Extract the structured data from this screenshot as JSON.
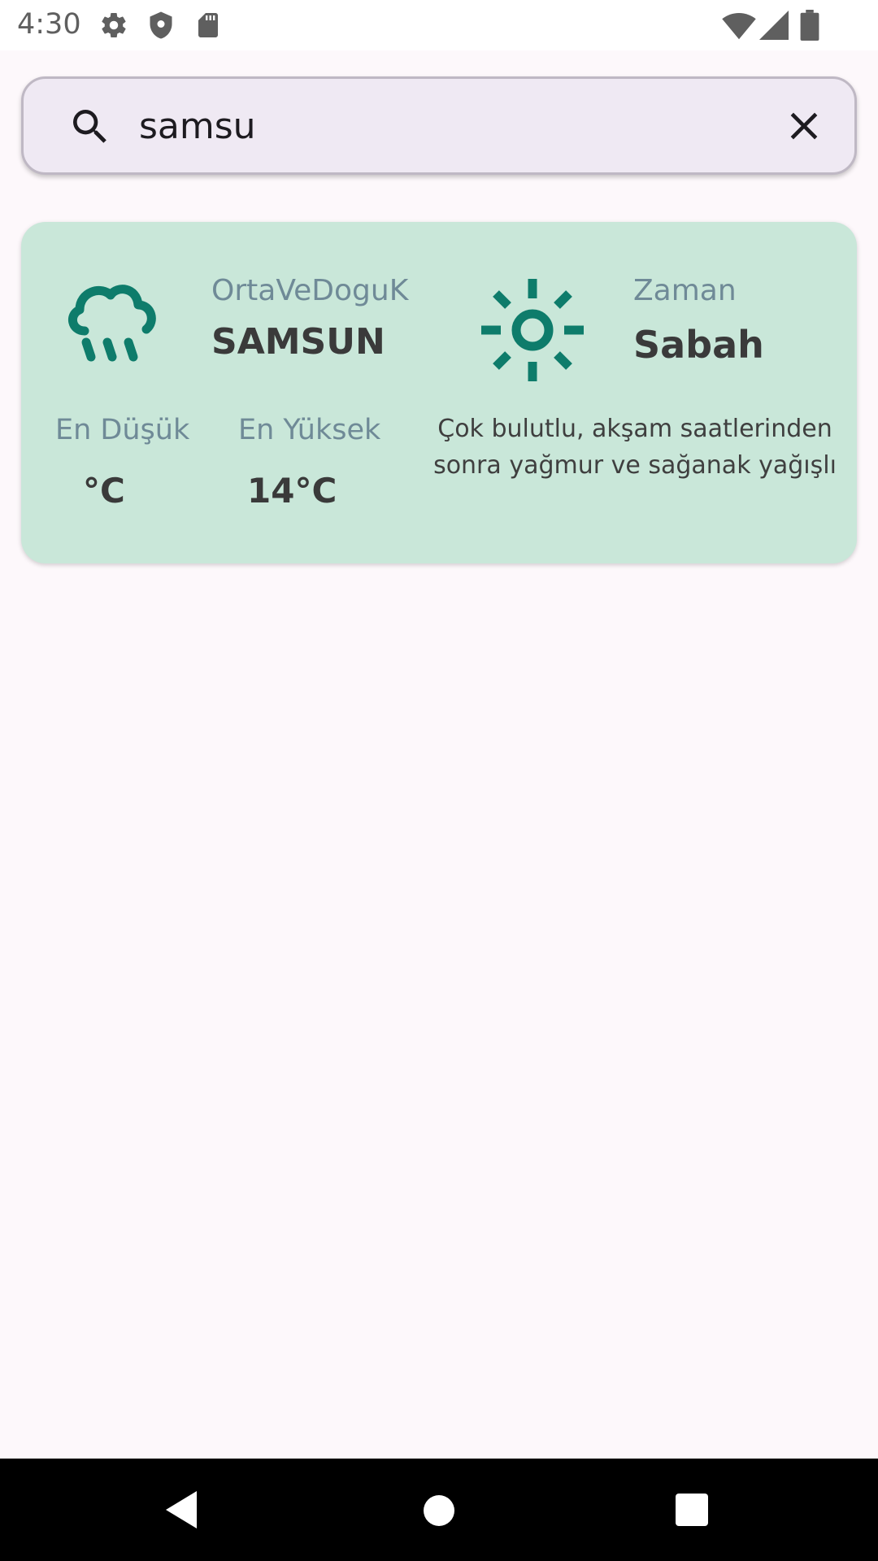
{
  "status_bar": {
    "time": "4:30",
    "left_icons": [
      "settings-icon",
      "shield-icon",
      "sd-card-icon"
    ],
    "right_icons": [
      "wifi-icon",
      "signal-icon",
      "battery-icon"
    ]
  },
  "search": {
    "value": "samsu",
    "icon": "search-icon",
    "clear_icon": "close-icon"
  },
  "weather_card": {
    "region": "OrtaVeDoguK",
    "city": "SAMSUN",
    "weather_icon": "rain-cloud-icon",
    "time_label": "Zaman",
    "time_value": "Sabah",
    "time_icon": "sun-icon",
    "min_label": "En Düşük",
    "min_value": "°C",
    "max_label": "En Yüksek",
    "max_value": "14°C",
    "description": "Çok bulutlu, akşam saatlerinden sonra yağmur ve sağanak yağışlı"
  },
  "colors": {
    "card_background": "#c9e7d9",
    "icon_accent": "#0e7c6b",
    "label_text": "#6f8a97",
    "search_background": "#efe9f3"
  },
  "nav_bar": {
    "buttons": [
      "back-icon",
      "home-icon",
      "recents-icon"
    ]
  }
}
